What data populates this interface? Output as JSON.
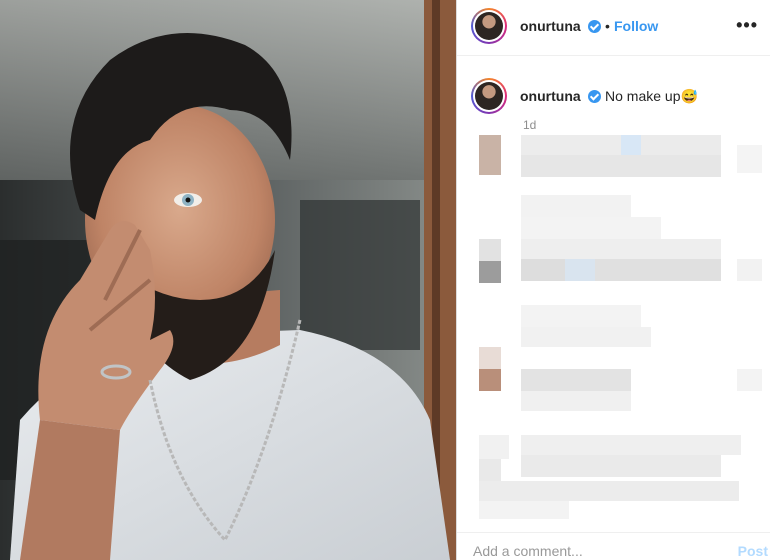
{
  "post": {
    "username": "onurtuna",
    "follow_label": "Follow",
    "separator": "•",
    "more_label": "•••",
    "caption": "No make up😅",
    "time_ago": "1d",
    "comment_placeholder": "Add a comment...",
    "post_label": "Post"
  },
  "colors": {
    "accent": "#3897f0",
    "text": "#262626",
    "muted": "#8e8e8e"
  }
}
